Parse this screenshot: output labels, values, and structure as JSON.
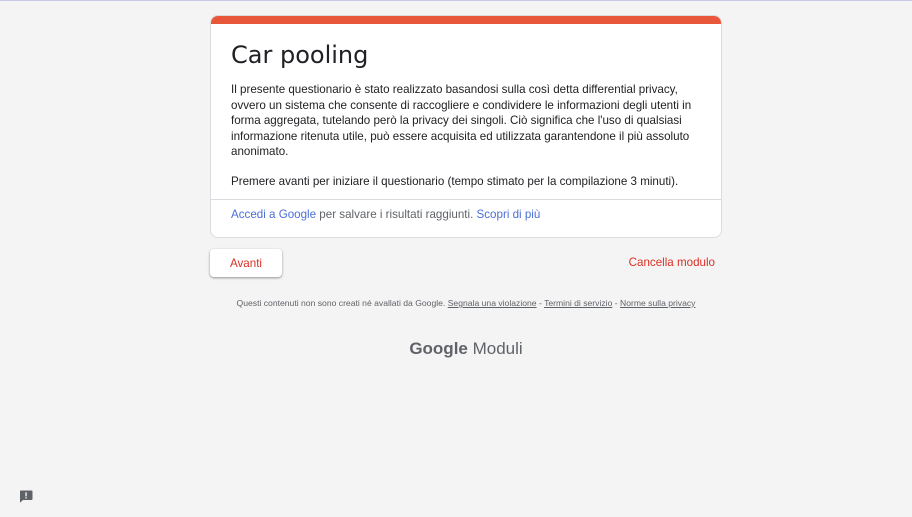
{
  "form": {
    "title": "Car pooling",
    "description_1": "Il presente questionario è stato realizzato basandosi sulla così detta differential privacy, ovvero un sistema che consente di raccogliere e condividere le informazioni degli utenti in forma aggregata, tutelando però la privacy dei singoli. Ciò significa che l'uso di qualsiasi informazione ritenuta utile, può essere acquisita ed utilizzata garantendone il più assoluto anonimato.",
    "description_2": "Premere avanti per iniziare il questionario (tempo stimato per la compilazione 3 minuti).",
    "footer": {
      "signin_link": "Accedi a Google",
      "signin_text": " per salvare i risultati raggiunti. ",
      "learn_more_link": "Scopri di più"
    },
    "accent_color": "#e8573a"
  },
  "actions": {
    "next_label": "Avanti",
    "clear_label": "Cancella modulo"
  },
  "disclaimer": {
    "text": "Questi contenuti non sono creati né avallati da Google. ",
    "report_link": "Segnala una violazione",
    "sep1": " - ",
    "terms_link": "Termini di servizio",
    "sep2": " - ",
    "privacy_link": "Norme sulla privacy"
  },
  "branding": {
    "google": "Google",
    "product": " Moduli"
  },
  "icons": {
    "feedback": "report-feedback-icon"
  }
}
